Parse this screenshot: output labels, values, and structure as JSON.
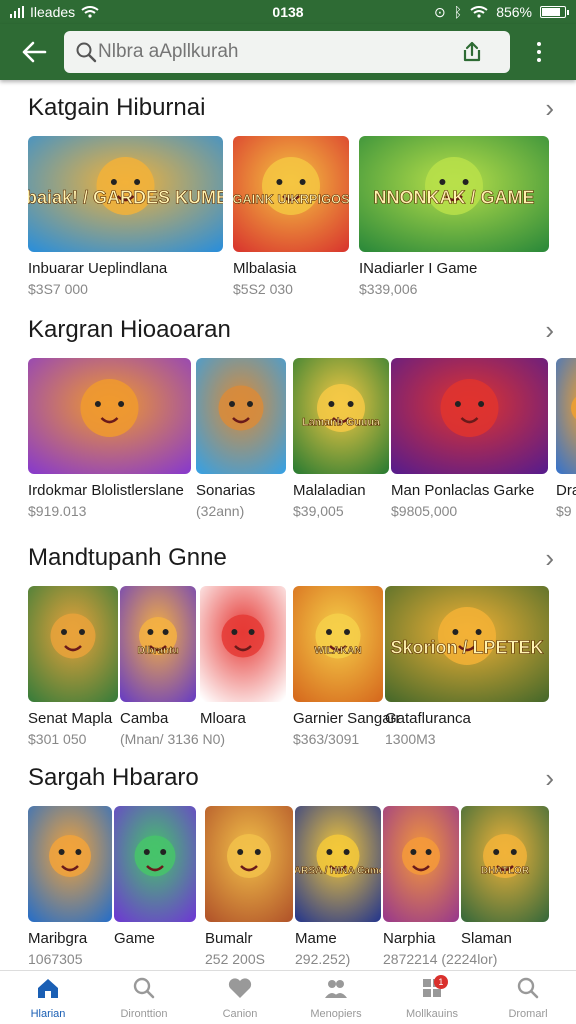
{
  "status": {
    "carrier": "Ileades",
    "time": "0138",
    "battery": "856%",
    "battery_level": 0.856
  },
  "search": {
    "placeholder": "Nlbra aApllkurah"
  },
  "sections": [
    {
      "title": "Katgain Hiburnai",
      "items": [
        {
          "name": "Inbuarar Ueplindlana",
          "meta": "$3S7 000",
          "art": "Inbaiak! / GARDES KUMBS",
          "colors": [
            "#2f8fd6",
            "#f2b23a"
          ]
        },
        {
          "name": "Mlbalasia",
          "meta": "$5S2 030",
          "art": "GAINK UIKRPIGOS",
          "colors": [
            "#d9382e",
            "#f5c542"
          ]
        },
        {
          "name": "INadiarler I Game",
          "meta": "$339,006",
          "art": "NNONKAK / GAME",
          "colors": [
            "#2e8b3a",
            "#b9e04a"
          ]
        }
      ]
    },
    {
      "title": "Kargran Hioaoaran",
      "items": [
        {
          "name": "Irdokmar Blolistlerslane",
          "meta": "$919.013",
          "colors": [
            "#8a3cc8",
            "#f09a2e"
          ]
        },
        {
          "name": "Sonarias",
          "meta": "(32ann)",
          "colors": [
            "#3aa0e0",
            "#d98b3a"
          ]
        },
        {
          "name": "Malaladian",
          "meta": "$39,005",
          "art": "Lamanb Guuua",
          "colors": [
            "#2e7d32",
            "#f6c945"
          ]
        },
        {
          "name": "Man Ponlaclas Garke",
          "meta": "$9805,000",
          "colors": [
            "#5a1c8a",
            "#e0342e"
          ]
        },
        {
          "name": "Dra",
          "meta": "$9",
          "colors": [
            "#3a74c8",
            "#f0a030"
          ]
        }
      ]
    },
    {
      "title": "Mandtupanh Gnne",
      "items": [
        {
          "name": "Senat Mapla",
          "meta": "$301 050",
          "colors": [
            "#3b7d3a",
            "#e9a23b"
          ]
        },
        {
          "name": "Camba",
          "meta": "(Mnan/ 3136 N0)",
          "art": "Dlbrantu",
          "colors": [
            "#6a3fc0",
            "#f5b142"
          ]
        },
        {
          "name": "Mloara",
          "meta": "",
          "colors": [
            "#ffffff",
            "#e53935"
          ]
        },
        {
          "name": "Garnier Sangarr",
          "meta": "$363/3091",
          "art": "WILAKAN",
          "colors": [
            "#d66a1e",
            "#f6d04a"
          ]
        },
        {
          "name": "Gatafluranca",
          "meta": "1300M3",
          "art": "Skorion / LPETEK",
          "colors": [
            "#4a6a2a",
            "#f3b236"
          ]
        }
      ]
    },
    {
      "title": "Sargah Hbararo",
      "items": [
        {
          "name": "Maribgra",
          "meta": "1067305",
          "colors": [
            "#2b6fc4",
            "#f2a33b"
          ]
        },
        {
          "name": "Game",
          "meta": "",
          "colors": [
            "#6d3bd1",
            "#46c46a"
          ]
        },
        {
          "name": "Bumalr",
          "meta": "252 200S",
          "colors": [
            "#b2552a",
            "#f2c14a"
          ]
        },
        {
          "name": "Mame",
          "meta": "292.252)",
          "art": "GARSA / HINA Cames",
          "colors": [
            "#2a3a8a",
            "#f5c93a"
          ]
        },
        {
          "name": "Narphia",
          "meta": "2872214 (2224lor)",
          "colors": [
            "#9a3a8a",
            "#f49a3a"
          ]
        },
        {
          "name": "Slaman",
          "meta": "",
          "art": "DHATLOR",
          "colors": [
            "#3a6a3a",
            "#f1b33a"
          ]
        }
      ]
    }
  ],
  "nav": [
    {
      "label": "Hlarian",
      "icon": "home-icon",
      "active": true
    },
    {
      "label": "Dironttion",
      "icon": "search-icon"
    },
    {
      "label": "Canion",
      "icon": "heart-icon"
    },
    {
      "label": "Menopiers",
      "icon": "people-icon"
    },
    {
      "label": "Mollkauins",
      "icon": "grid-icon",
      "badge": "1"
    },
    {
      "label": "Dromarl",
      "icon": "search-icon"
    }
  ]
}
